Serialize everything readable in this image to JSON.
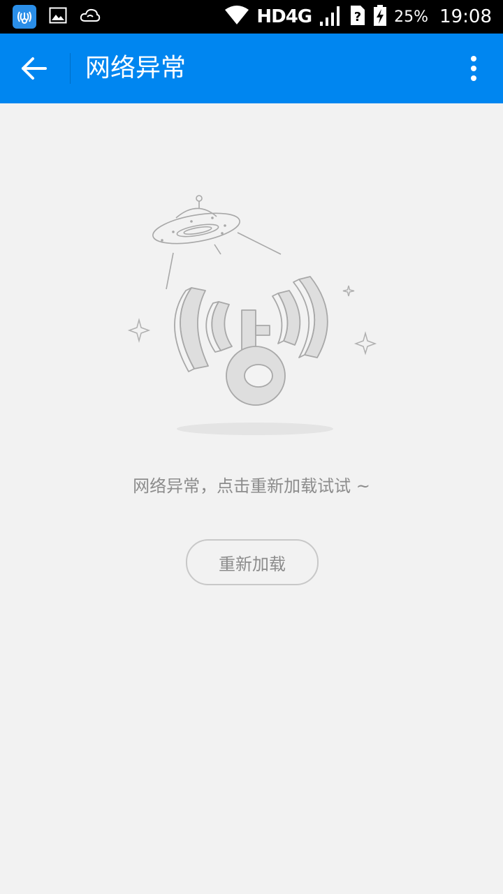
{
  "status_bar": {
    "network": "HD4G",
    "battery": "25%",
    "time": "19:08",
    "icons": [
      "wifi-key-app-icon",
      "image-icon",
      "cloud-sync-icon",
      "wifi-icon",
      "signal-icon",
      "sim-unknown-icon",
      "battery-charging-icon"
    ]
  },
  "app_bar": {
    "title": "网络异常",
    "background_color": "#0086f0"
  },
  "content": {
    "illustration": "network-error-illustration",
    "message": "网络异常，点击重新加载试试 ~",
    "reload_button": "重新加载"
  }
}
